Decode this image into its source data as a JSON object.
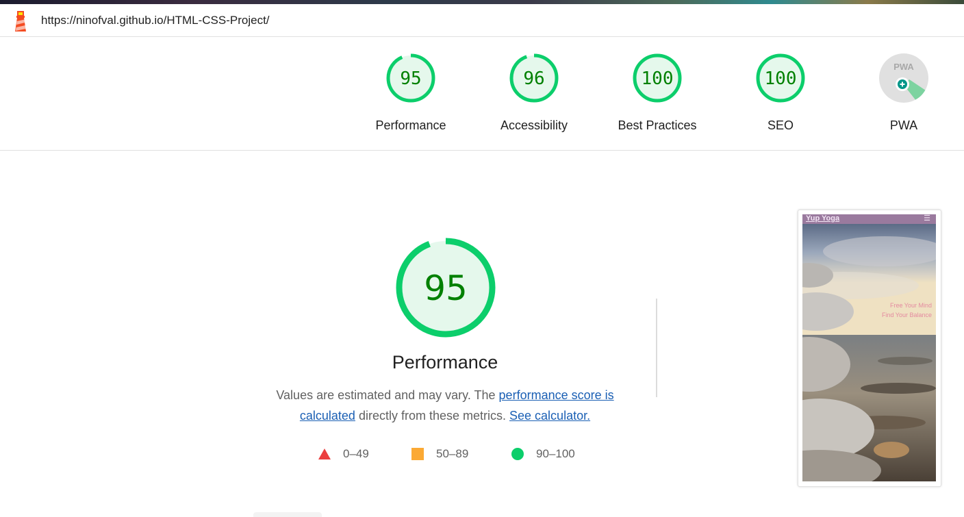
{
  "url": "https://ninofval.github.io/HTML-CSS-Project/",
  "scores": [
    {
      "label": "Performance",
      "value": "95",
      "score": 95
    },
    {
      "label": "Accessibility",
      "value": "96",
      "score": 96
    },
    {
      "label": "Best Practices",
      "value": "100",
      "score": 100
    },
    {
      "label": "SEO",
      "value": "100",
      "score": 100
    },
    {
      "label": "PWA",
      "value": "PWA"
    }
  ],
  "main": {
    "score": "95",
    "score_value": 95,
    "title": "Performance",
    "desc_part1": "Values are estimated and may vary. The ",
    "desc_link1": "performance score is calculated",
    "desc_part2": " directly from these metrics. ",
    "desc_link2": "See calculator."
  },
  "legend": [
    {
      "range": "0–49",
      "color": "#eb3f3f",
      "shape": "triangle"
    },
    {
      "range": "50–89",
      "color": "#fba934",
      "shape": "square"
    },
    {
      "range": "90–100",
      "color": "#0cce6b",
      "shape": "circle"
    }
  ],
  "screenshot": {
    "brand": "Yup Yoga",
    "menu_icon": "☰",
    "tagline1": "Free Your Mind",
    "tagline2": "Find Your Balance"
  },
  "colors": {
    "pass": "#0cce6b",
    "pass_text": "#008000",
    "pass_fill": "#e5f8ec",
    "link": "#1a5fb4"
  }
}
